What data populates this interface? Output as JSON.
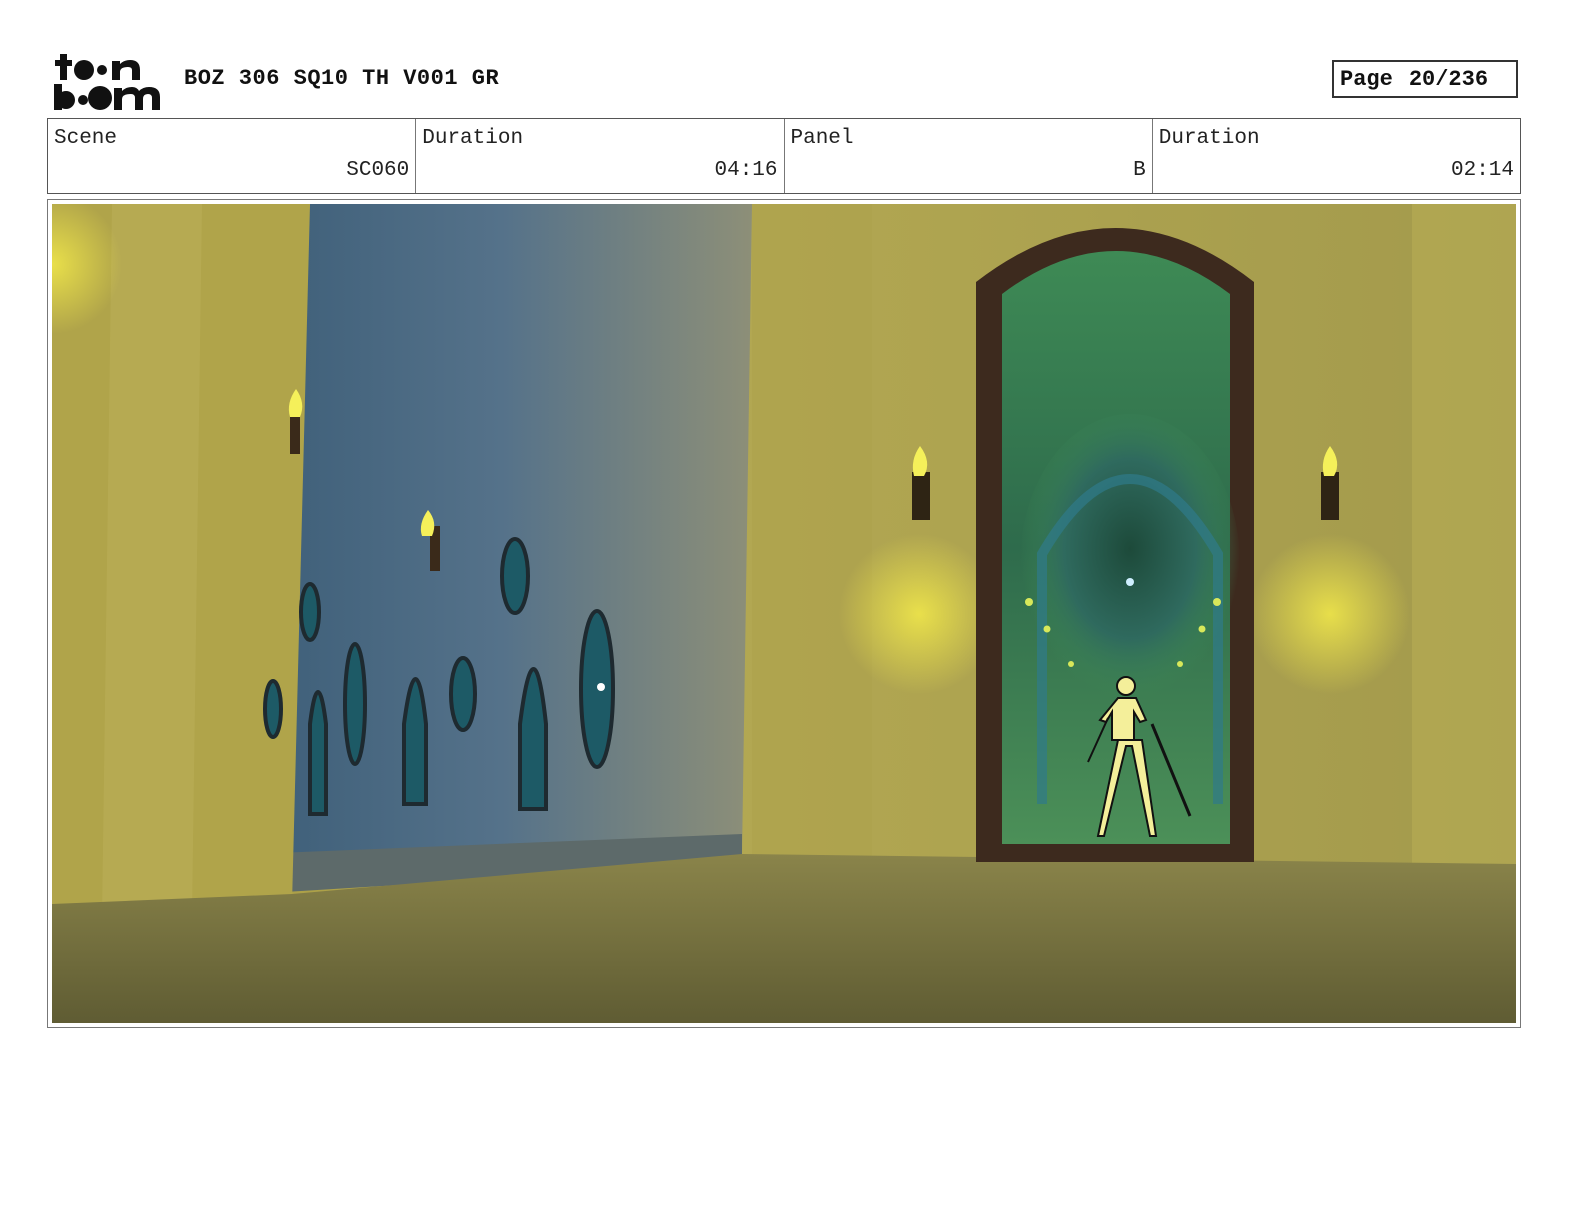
{
  "header": {
    "logo_text_top": "toon",
    "logo_text_bottom": "boom",
    "title": "BOZ 306 SQ10 TH V001 GR",
    "page_label": "Page",
    "page_number": "20/236"
  },
  "info": {
    "scene_label": "Scene",
    "scene_value": "SC060",
    "scene_duration_label": "Duration",
    "scene_duration_value": "04:16",
    "panel_label": "Panel",
    "panel_value": "B",
    "panel_duration_label": "Duration",
    "panel_duration_value": "02:14"
  },
  "colors": {
    "wall": "#b7a850",
    "corridor": "#4e6f86",
    "mirror_frame": "#3d2a1e",
    "mirror_glass": "#3f8a57",
    "torch_flame": "#f5f05a",
    "floor": "#6e6a38"
  }
}
